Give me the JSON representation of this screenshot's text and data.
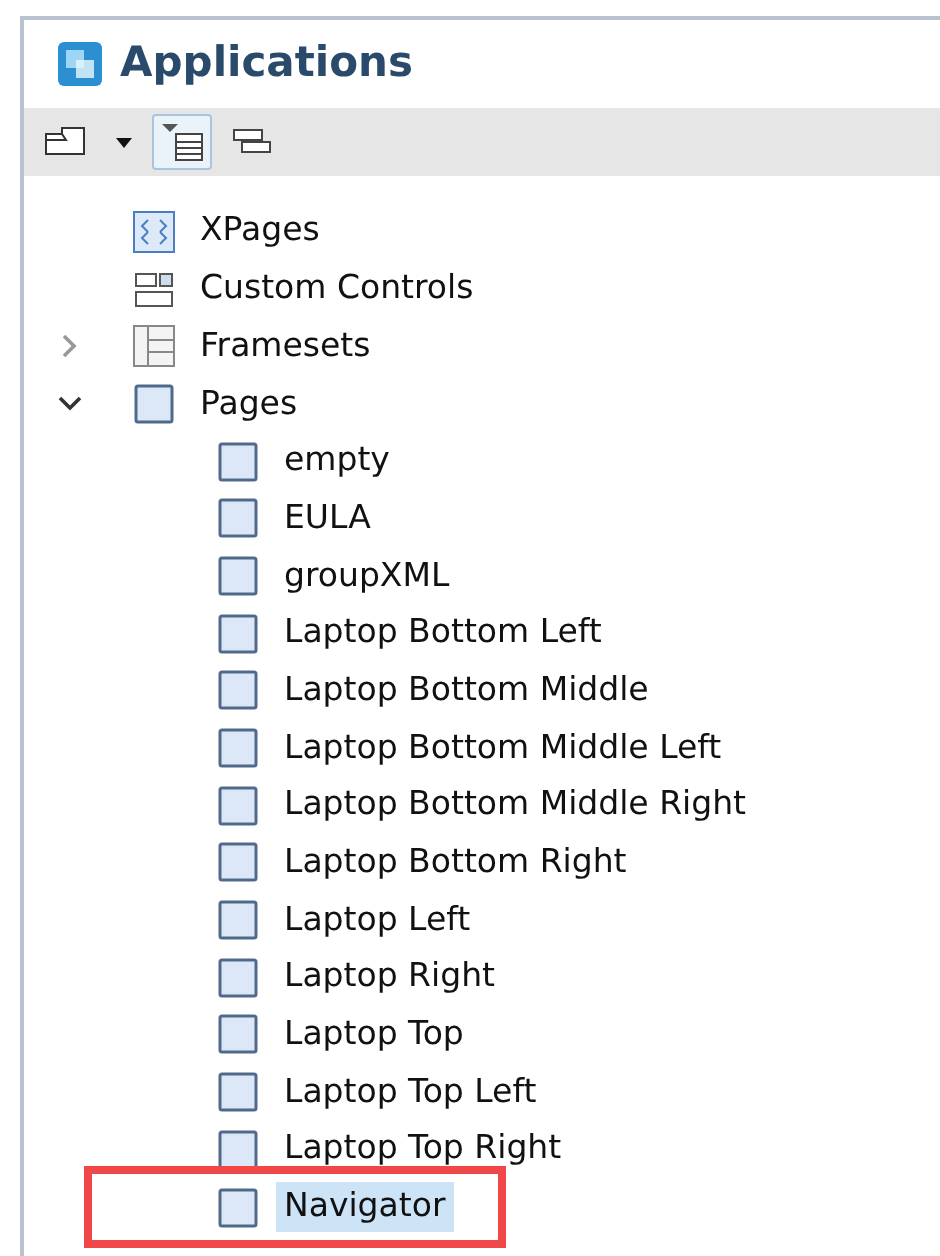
{
  "panel": {
    "title": "Applications"
  },
  "toolbar": [
    {
      "kind": "new",
      "pressed": false
    },
    {
      "kind": "dropdown",
      "pressed": false
    },
    {
      "kind": "tree",
      "pressed": true
    },
    {
      "kind": "collapse",
      "pressed": false
    }
  ],
  "tree": [
    {
      "label": "XPages",
      "kind": "xpages",
      "selected": false
    },
    {
      "label": "Custom Controls",
      "kind": "controls",
      "selected": false
    },
    {
      "label": "Framesets",
      "kind": "frameset",
      "expanded": false,
      "selected": false
    },
    {
      "label": "Pages",
      "kind": "page",
      "expanded": true,
      "selected": false,
      "children": [
        {
          "label": "empty",
          "kind": "page",
          "selected": false
        },
        {
          "label": "EULA",
          "kind": "page",
          "selected": false
        },
        {
          "label": "groupXML",
          "kind": "page",
          "selected": false
        },
        {
          "label": "Laptop Bottom Left",
          "kind": "page",
          "selected": false
        },
        {
          "label": "Laptop Bottom Middle",
          "kind": "page",
          "selected": false
        },
        {
          "label": "Laptop Bottom Middle Left",
          "kind": "page",
          "selected": false
        },
        {
          "label": "Laptop Bottom Middle Right",
          "kind": "page",
          "selected": false
        },
        {
          "label": "Laptop Bottom Right",
          "kind": "page",
          "selected": false
        },
        {
          "label": "Laptop Left",
          "kind": "page",
          "selected": false
        },
        {
          "label": "Laptop Right",
          "kind": "page",
          "selected": false
        },
        {
          "label": "Laptop Top",
          "kind": "page",
          "selected": false
        },
        {
          "label": "Laptop Top Left",
          "kind": "page",
          "selected": false
        },
        {
          "label": "Laptop Top Right",
          "kind": "page",
          "selected": false
        },
        {
          "label": "Navigator",
          "kind": "page",
          "selected": true,
          "callout": true
        }
      ]
    }
  ]
}
